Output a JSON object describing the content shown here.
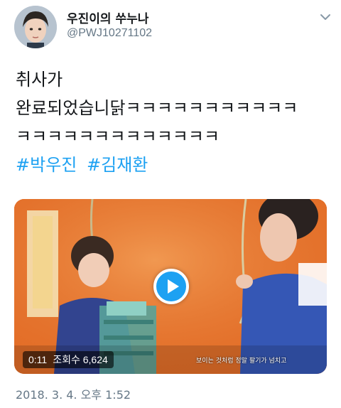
{
  "user": {
    "display_name": "우진이의 쑤누나",
    "handle": "@PWJ10271102"
  },
  "tweet": {
    "lines": [
      "취사가",
      "완료되었습니닭ㅋㅋㅋㅋㅋㅋㅋㅋㅋㅋㅋ",
      "ㅋㅋㅋㅋㅋㅋㅋㅋㅋㅋㅋㅋㅋ"
    ],
    "hashtags": [
      "#박우진",
      "#김재환"
    ]
  },
  "media": {
    "duration": "0:11",
    "views": "조회수 6,624",
    "subtitle": "보이는 것처럼 정말 팔기가 넘치고"
  },
  "timestamp": "2018. 3. 4. 오후 1:52",
  "icons": {
    "caret": "chevron-down-icon",
    "play": "play-icon"
  },
  "colors": {
    "link": "#1da1f2",
    "secondary_text": "#657786",
    "video_background": "#e8742b"
  }
}
